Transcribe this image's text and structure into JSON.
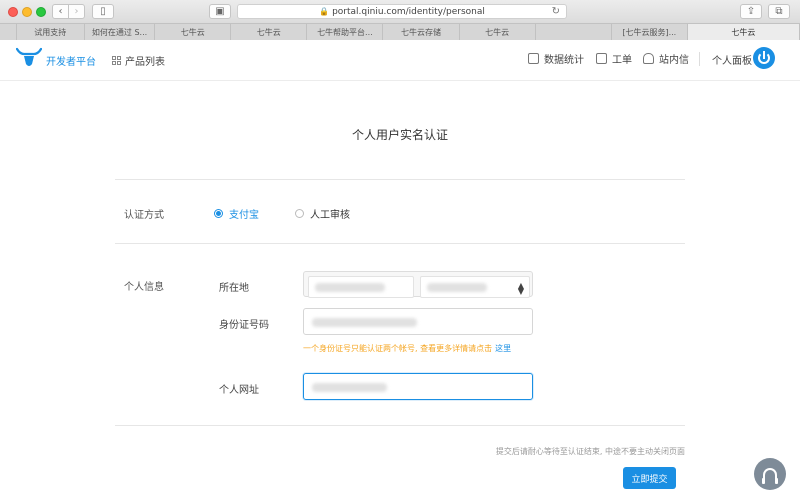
{
  "browser": {
    "url": "portal.qiniu.com/identity/personal",
    "tabs": [
      "",
      "试用支持",
      "如何在通过 S...",
      "七牛云",
      "七牛云",
      "七牛帮助平台...",
      "七牛云存储",
      "七牛云",
      "",
      "[七牛云服务]...",
      "七牛云"
    ],
    "active_tab_index": 10
  },
  "header": {
    "brand": "开发者平台",
    "products": "产品列表",
    "nav": [
      "数据统计",
      "工单",
      "站内信"
    ],
    "panel": "个人面板"
  },
  "page": {
    "title": "个人用户实名认证",
    "auth_method_label": "认证方式",
    "auth_options": [
      "支付宝",
      "人工审核"
    ],
    "selected_auth_option": "支付宝",
    "personal_info_label": "个人信息",
    "location_label": "所在地",
    "id_label": "身份证号码",
    "hint_text": "一个身份证号只能认证两个帐号, 查看更多详情请点击",
    "hint_link": "这里",
    "website_label": "个人网址",
    "note": "提交后请耐心等待至认证结束, 中途不要主动关闭页面",
    "submit": "立即提交"
  },
  "colors": {
    "accent": "#1a8fe3",
    "hint": "#f5a623"
  },
  "icons": [
    "lock-icon",
    "reload-icon",
    "grid-icon",
    "chart-icon",
    "clipboard-icon",
    "bell-icon",
    "power-icon",
    "headset-icon"
  ]
}
